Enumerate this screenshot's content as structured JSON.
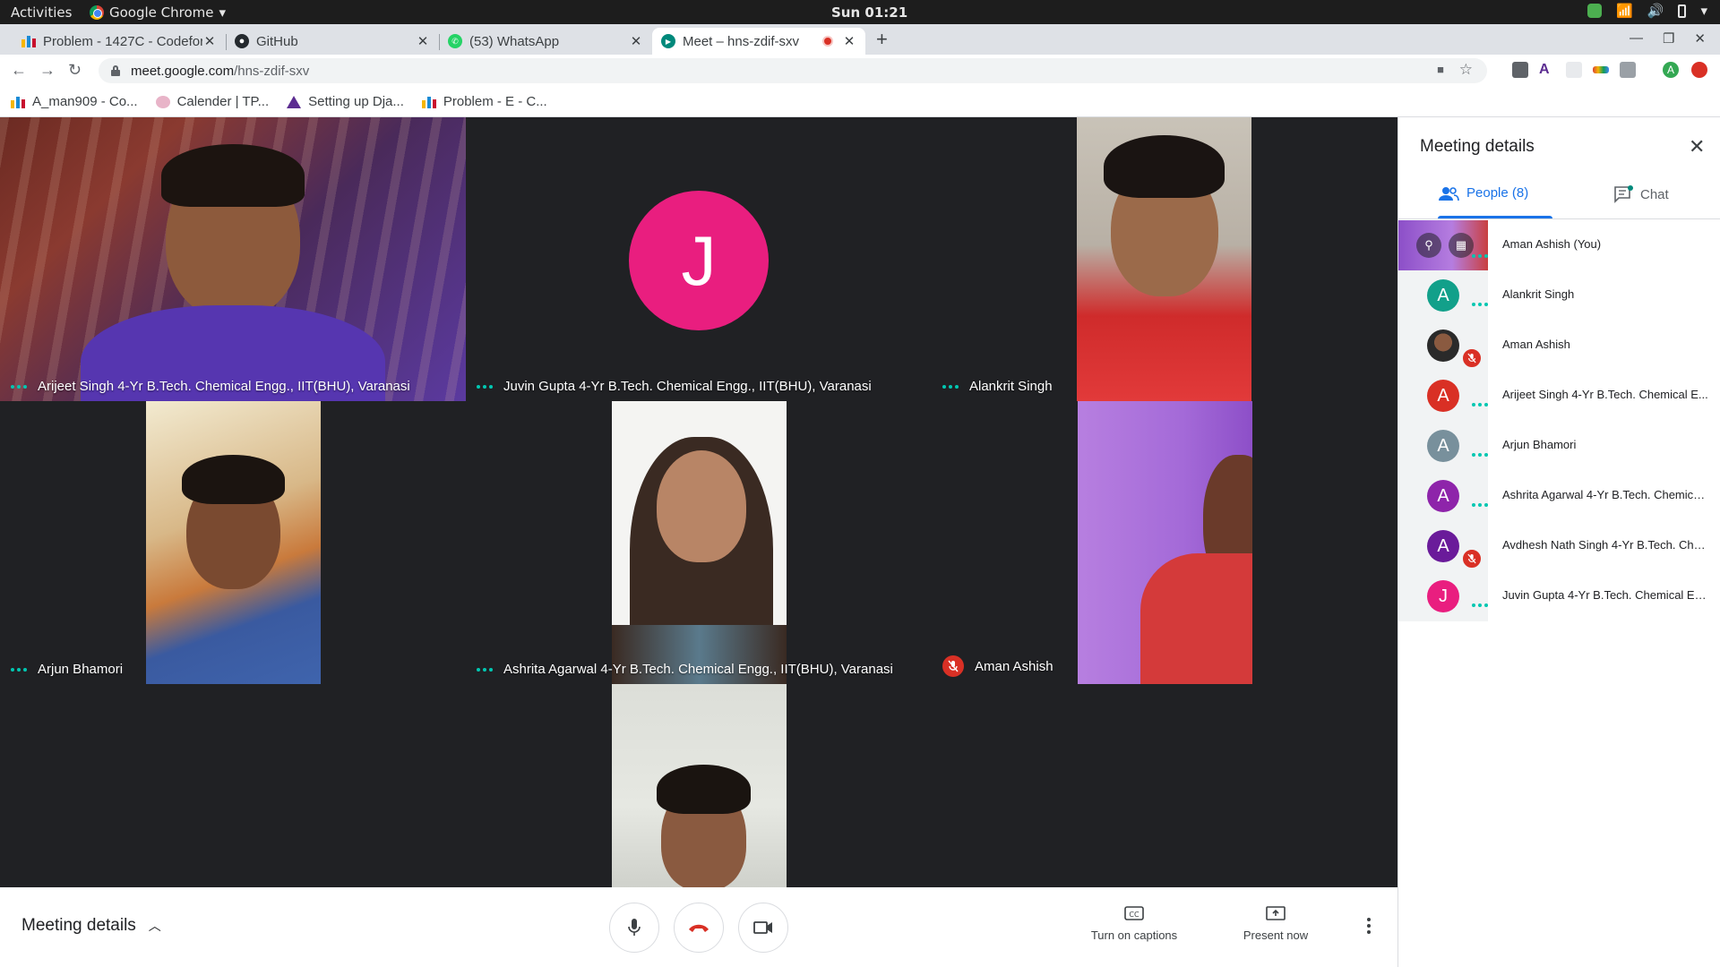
{
  "os": {
    "activities": "Activities",
    "app_name": "Google Chrome",
    "clock": "Sun 01:21"
  },
  "browser": {
    "tabs": [
      {
        "title": "Problem - 1427C - Codefor",
        "icon": "codeforces-icon"
      },
      {
        "title": "GitHub",
        "icon": "github-icon"
      },
      {
        "title": "(53) WhatsApp",
        "icon": "whatsapp-icon"
      },
      {
        "title": "Meet – hns-zdif-sxv",
        "icon": "meet-icon",
        "active": true
      }
    ],
    "url_host": "meet.google.com",
    "url_path": "/hns-zdif-sxv",
    "bookmarks": [
      {
        "label": "A_man909 - Co...",
        "icon": "codeforces-icon"
      },
      {
        "label": "Calender | TP...",
        "icon": "calendar-icon"
      },
      {
        "label": "Setting up Dja...",
        "icon": "triangle-icon"
      },
      {
        "label": "Problem - E - C...",
        "icon": "codeforces-icon"
      }
    ]
  },
  "tiles": [
    {
      "name": "Arijeet Singh 4-Yr B.Tech. Chemical Engg., IIT(BHU), Varanasi",
      "status": "speaking"
    },
    {
      "name": "Juvin Gupta 4-Yr B.Tech. Chemical Engg., IIT(BHU), Varanasi",
      "status": "speaking",
      "avatar_letter": "J"
    },
    {
      "name": "Alankrit Singh",
      "status": "speaking"
    },
    {
      "name": "Arjun Bhamori",
      "status": "speaking"
    },
    {
      "name": "Ashrita Agarwal 4-Yr B.Tech. Chemical Engg., IIT(BHU), Varanasi",
      "status": "speaking"
    },
    {
      "name": "Aman Ashish",
      "status": "muted"
    },
    {
      "name": "",
      "status": "self"
    }
  ],
  "controls": {
    "meeting_details": "Meeting details",
    "captions": "Turn on captions",
    "present": "Present now"
  },
  "panel": {
    "title": "Meeting details",
    "tab_people": "People (8)",
    "tab_chat": "Chat",
    "people": [
      {
        "name": "Aman Ashish (You)",
        "self": true
      },
      {
        "name": "Alankrit Singh",
        "letter": "A",
        "color": "#12a08a",
        "muted": false
      },
      {
        "name": "Aman Ashish",
        "photo": true,
        "muted": true
      },
      {
        "name": "Arijeet Singh 4-Yr B.Tech. Chemical E...",
        "letter": "A",
        "color": "#d93025",
        "muted": false
      },
      {
        "name": "Arjun Bhamori",
        "letter": "A",
        "color": "#78909c",
        "muted": false
      },
      {
        "name": "Ashrita Agarwal 4-Yr B.Tech. Chemica...",
        "letter": "A",
        "color": "#8e24aa",
        "muted": false
      },
      {
        "name": "Avdhesh Nath Singh 4-Yr B.Tech. Che...",
        "letter": "A",
        "color": "#6a1b9a",
        "muted": true
      },
      {
        "name": "Juvin Gupta 4-Yr B.Tech. Chemical En...",
        "letter": "J",
        "color": "#e91e7f",
        "muted": false
      }
    ]
  }
}
